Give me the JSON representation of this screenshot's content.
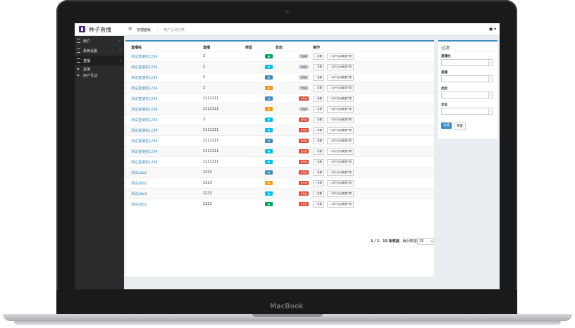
{
  "device": {
    "brand": "MacBook"
  },
  "app": {
    "title": "种子直播",
    "user_icon": "user-icon"
  },
  "breadcrumb": {
    "home_icon": "home-icon",
    "item1": "管理面板",
    "separator": "/",
    "item2": "用户互动列表"
  },
  "sidebar": {
    "items": [
      {
        "label": "用户",
        "icon": "list-icon"
      },
      {
        "label": "系统设置",
        "icon": "list-icon"
      },
      {
        "label": "直播",
        "icon": "list-icon"
      }
    ],
    "subitems": [
      {
        "label": "直播"
      },
      {
        "label": "用户互动"
      }
    ]
  },
  "table": {
    "columns": [
      "直播柱",
      "直播",
      "类型",
      "状态",
      "操作"
    ],
    "rows": [
      {
        "name": "测试直播柱1234",
        "live": "2",
        "type_color": "#00a65a",
        "status": "已结束",
        "status_color": "#d2d6de"
      },
      {
        "name": "测试直播柱1234",
        "live": "2",
        "type_color": "#00c0ef",
        "status": "已结束",
        "status_color": "#d2d6de"
      },
      {
        "name": "测试直播柱1234",
        "live": "2",
        "type_color": "#3c8dbc",
        "status": "已结束",
        "status_color": "#d2d6de"
      },
      {
        "name": "测试直播柱1234",
        "live": "2",
        "type_color": "#f39c12",
        "status": "已结束",
        "status_color": "#d2d6de"
      },
      {
        "name": "测试直播柱1234",
        "live": "1111111",
        "type_color": "#3c8dbc",
        "status": "未开始",
        "status_color": "#dd4b39"
      },
      {
        "name": "测试直播柱1234",
        "live": "1111111",
        "type_color": "#f39c12",
        "status": "已结束",
        "status_color": "#d2d6de"
      },
      {
        "name": "测试直播柱1234",
        "live": "3",
        "type_color": "#00c0ef",
        "status": "未开始",
        "status_color": "#dd4b39"
      },
      {
        "name": "测试直播柱1234",
        "live": "1111111",
        "type_color": "#00c0ef",
        "status": "未开始",
        "status_color": "#dd4b39"
      },
      {
        "name": "测试直播柱1234",
        "live": "1111111",
        "type_color": "#3c8dbc",
        "status": "未开始",
        "status_color": "#dd4b39"
      },
      {
        "name": "测试直播柱1234",
        "live": "1111111",
        "type_color": "#00c0ef",
        "status": "未开始",
        "status_color": "#dd4b39"
      },
      {
        "name": "测试直播柱1234",
        "live": "1111111",
        "type_color": "#00c0ef",
        "status": "未开始",
        "status_color": "#dd4b39"
      },
      {
        "name": "测试xbb2",
        "live": "2223",
        "type_color": "#3c8dbc",
        "status": "未开始",
        "status_color": "#dd4b39"
      },
      {
        "name": "测试xbb2",
        "live": "2223",
        "type_color": "#f39c12",
        "status": "未开始",
        "status_color": "#dd4b39"
      },
      {
        "name": "测试xbb2",
        "live": "2223",
        "type_color": "#00c0ef",
        "status": "未开始",
        "status_color": "#dd4b39"
      },
      {
        "name": "测试xbb2",
        "live": "2223",
        "type_color": "#00a65a",
        "status": "未开始",
        "status_color": "#dd4b39"
      }
    ],
    "action_view": "查看",
    "action_download": "用户互动数据下载"
  },
  "pagination": {
    "page": "1 / 1",
    "total": "15 条数据",
    "per_page_label": "每页数据",
    "per_page": "25"
  },
  "filter": {
    "title": "过滤",
    "fields": [
      "直播柱",
      "直播",
      "类型",
      "状态"
    ],
    "submit": "过滤",
    "reset": "重置"
  }
}
